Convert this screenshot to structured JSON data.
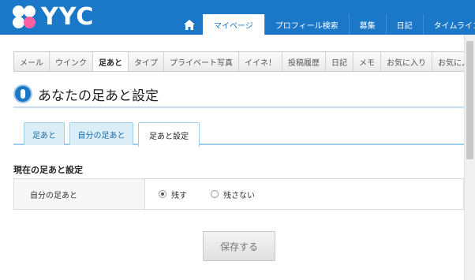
{
  "header": {
    "logo_text": "YYC",
    "nav": [
      {
        "label": "マイページ",
        "active": true
      },
      {
        "label": "プロフィール検索",
        "active": false
      },
      {
        "label": "募集",
        "active": false
      },
      {
        "label": "日記",
        "active": false
      },
      {
        "label": "タイムライン",
        "active": false
      }
    ]
  },
  "subnav": [
    {
      "label": "メール"
    },
    {
      "label": "ウインク"
    },
    {
      "label": "足あと",
      "active": true
    },
    {
      "label": "タイプ"
    },
    {
      "label": "プライベート写真"
    },
    {
      "label": "イイネ！"
    },
    {
      "label": "投稿履歴"
    },
    {
      "label": "日記"
    },
    {
      "label": "メモ"
    },
    {
      "label": "お気に入り"
    },
    {
      "label": "お気に入"
    }
  ],
  "page": {
    "title": "あなたの足あと設定"
  },
  "tabs": [
    {
      "label": "足あと"
    },
    {
      "label": "自分の足あと"
    },
    {
      "label": "足あと設定",
      "active": true
    }
  ],
  "setting": {
    "heading": "現在の足あと設定",
    "label": "自分の足あと",
    "options": [
      {
        "label": "残す",
        "selected": true
      },
      {
        "label": "残さない",
        "selected": false
      }
    ]
  },
  "save_label": "保存する",
  "colors": {
    "brand_blue": "#1b78c9",
    "tab_blue": "#dbeef8",
    "logo_pink": "#ff5fa0"
  }
}
